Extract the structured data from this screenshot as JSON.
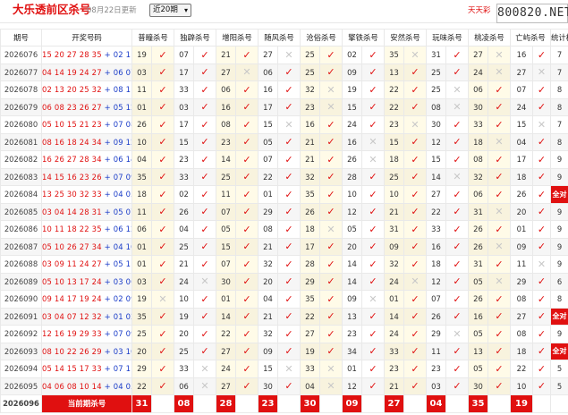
{
  "header": {
    "title": "大乐透前区杀号",
    "update_time": "08月22日更新",
    "period_select": "近20期",
    "site_name": "天天彩",
    "watermark": "800820.NET"
  },
  "table": {
    "headers": [
      "期号",
      "开奖号码",
      "普疃杀号",
      "独辟杀号",
      "增阳杀号",
      "随风杀号",
      "沧俗杀号",
      "擎铁杀号",
      "安然杀号",
      "玩味杀号",
      "桃凌杀号",
      "亡屿杀号",
      "统计概况"
    ],
    "rows": [
      {
        "issue": "2026076",
        "front": "15 20 27 28 35",
        "back": "02 11",
        "kills": [
          [
            "19",
            "ok"
          ],
          [
            "07",
            "ok"
          ],
          [
            "21",
            "ok"
          ],
          [
            "27",
            "no"
          ],
          [
            "25",
            "ok"
          ],
          [
            "02",
            "ok"
          ],
          [
            "35",
            "no"
          ],
          [
            "31",
            "ok"
          ],
          [
            "27",
            "no"
          ],
          [
            "16",
            "ok"
          ]
        ],
        "count": "7"
      },
      {
        "issue": "2026077",
        "front": "04 14 19 24 27",
        "back": "06 07",
        "kills": [
          [
            "03",
            "ok"
          ],
          [
            "17",
            "ok"
          ],
          [
            "27",
            "no"
          ],
          [
            "06",
            "ok"
          ],
          [
            "25",
            "ok"
          ],
          [
            "09",
            "ok"
          ],
          [
            "13",
            "ok"
          ],
          [
            "25",
            "ok"
          ],
          [
            "24",
            "no"
          ],
          [
            "27",
            "no"
          ]
        ],
        "count": "7"
      },
      {
        "issue": "2026078",
        "front": "02 13 20 25 32",
        "back": "08 11",
        "kills": [
          [
            "11",
            "ok"
          ],
          [
            "33",
            "ok"
          ],
          [
            "06",
            "ok"
          ],
          [
            "16",
            "ok"
          ],
          [
            "32",
            "no"
          ],
          [
            "19",
            "ok"
          ],
          [
            "22",
            "ok"
          ],
          [
            "25",
            "no"
          ],
          [
            "06",
            "ok"
          ],
          [
            "07",
            "ok"
          ]
        ],
        "count": "8"
      },
      {
        "issue": "2026079",
        "front": "06 08 23 26 27",
        "back": "05 12",
        "kills": [
          [
            "01",
            "ok"
          ],
          [
            "03",
            "ok"
          ],
          [
            "16",
            "ok"
          ],
          [
            "17",
            "ok"
          ],
          [
            "23",
            "no"
          ],
          [
            "15",
            "ok"
          ],
          [
            "22",
            "ok"
          ],
          [
            "08",
            "no"
          ],
          [
            "30",
            "ok"
          ],
          [
            "24",
            "ok"
          ]
        ],
        "count": "8"
      },
      {
        "issue": "2026080",
        "front": "05 10 15 21 23",
        "back": "07 08",
        "kills": [
          [
            "26",
            "ok"
          ],
          [
            "17",
            "ok"
          ],
          [
            "08",
            "ok"
          ],
          [
            "15",
            "no"
          ],
          [
            "16",
            "ok"
          ],
          [
            "24",
            "ok"
          ],
          [
            "23",
            "no"
          ],
          [
            "30",
            "ok"
          ],
          [
            "33",
            "ok"
          ],
          [
            "15",
            "no"
          ]
        ],
        "count": "7"
      },
      {
        "issue": "2026081",
        "front": "08 16 18 24 34",
        "back": "09 12",
        "kills": [
          [
            "10",
            "ok"
          ],
          [
            "15",
            "ok"
          ],
          [
            "23",
            "ok"
          ],
          [
            "05",
            "ok"
          ],
          [
            "21",
            "ok"
          ],
          [
            "16",
            "no"
          ],
          [
            "15",
            "ok"
          ],
          [
            "12",
            "ok"
          ],
          [
            "18",
            "no"
          ],
          [
            "04",
            "ok"
          ]
        ],
        "count": "8"
      },
      {
        "issue": "2026082",
        "front": "16 26 27 28 34",
        "back": "06 14",
        "kills": [
          [
            "04",
            "ok"
          ],
          [
            "23",
            "ok"
          ],
          [
            "14",
            "ok"
          ],
          [
            "07",
            "ok"
          ],
          [
            "21",
            "ok"
          ],
          [
            "26",
            "no"
          ],
          [
            "18",
            "ok"
          ],
          [
            "15",
            "ok"
          ],
          [
            "08",
            "ok"
          ],
          [
            "17",
            "ok"
          ]
        ],
        "count": "9"
      },
      {
        "issue": "2026083",
        "front": "14 15 16 23 26",
        "back": "07 09",
        "kills": [
          [
            "35",
            "ok"
          ],
          [
            "33",
            "ok"
          ],
          [
            "25",
            "ok"
          ],
          [
            "22",
            "ok"
          ],
          [
            "32",
            "ok"
          ],
          [
            "28",
            "ok"
          ],
          [
            "25",
            "ok"
          ],
          [
            "14",
            "no"
          ],
          [
            "32",
            "ok"
          ],
          [
            "18",
            "ok"
          ]
        ],
        "count": "9"
      },
      {
        "issue": "2026084",
        "front": "13 25 30 32 33",
        "back": "04 05",
        "kills": [
          [
            "18",
            "ok"
          ],
          [
            "02",
            "ok"
          ],
          [
            "11",
            "ok"
          ],
          [
            "01",
            "ok"
          ],
          [
            "35",
            "ok"
          ],
          [
            "10",
            "ok"
          ],
          [
            "10",
            "ok"
          ],
          [
            "27",
            "ok"
          ],
          [
            "06",
            "ok"
          ],
          [
            "26",
            "ok"
          ]
        ],
        "count": "全对"
      },
      {
        "issue": "2026085",
        "front": "03 04 14 28 31",
        "back": "05 07",
        "kills": [
          [
            "11",
            "ok"
          ],
          [
            "26",
            "ok"
          ],
          [
            "07",
            "ok"
          ],
          [
            "29",
            "ok"
          ],
          [
            "26",
            "ok"
          ],
          [
            "12",
            "ok"
          ],
          [
            "21",
            "ok"
          ],
          [
            "22",
            "ok"
          ],
          [
            "31",
            "no"
          ],
          [
            "20",
            "ok"
          ]
        ],
        "count": "9"
      },
      {
        "issue": "2026086",
        "front": "10 11 18 22 35",
        "back": "06 12",
        "kills": [
          [
            "06",
            "ok"
          ],
          [
            "04",
            "ok"
          ],
          [
            "05",
            "ok"
          ],
          [
            "08",
            "ok"
          ],
          [
            "18",
            "no"
          ],
          [
            "05",
            "ok"
          ],
          [
            "31",
            "ok"
          ],
          [
            "33",
            "ok"
          ],
          [
            "26",
            "ok"
          ],
          [
            "01",
            "ok"
          ]
        ],
        "count": "9"
      },
      {
        "issue": "2026087",
        "front": "05 10 26 27 34",
        "back": "04 10",
        "kills": [
          [
            "01",
            "ok"
          ],
          [
            "25",
            "ok"
          ],
          [
            "15",
            "ok"
          ],
          [
            "21",
            "ok"
          ],
          [
            "17",
            "ok"
          ],
          [
            "20",
            "ok"
          ],
          [
            "09",
            "ok"
          ],
          [
            "16",
            "ok"
          ],
          [
            "26",
            "no"
          ],
          [
            "09",
            "ok"
          ]
        ],
        "count": "9"
      },
      {
        "issue": "2026088",
        "front": "03 09 11 24 27",
        "back": "05 11",
        "kills": [
          [
            "01",
            "ok"
          ],
          [
            "21",
            "ok"
          ],
          [
            "07",
            "ok"
          ],
          [
            "32",
            "ok"
          ],
          [
            "28",
            "ok"
          ],
          [
            "14",
            "ok"
          ],
          [
            "32",
            "ok"
          ],
          [
            "18",
            "ok"
          ],
          [
            "31",
            "ok"
          ],
          [
            "11",
            "no"
          ]
        ],
        "count": "9"
      },
      {
        "issue": "2026089",
        "front": "05 10 13 17 24",
        "back": "03 06",
        "kills": [
          [
            "03",
            "ok"
          ],
          [
            "24",
            "no"
          ],
          [
            "30",
            "ok"
          ],
          [
            "20",
            "ok"
          ],
          [
            "29",
            "ok"
          ],
          [
            "14",
            "ok"
          ],
          [
            "24",
            "no"
          ],
          [
            "12",
            "ok"
          ],
          [
            "05",
            "no"
          ],
          [
            "29",
            "ok"
          ]
        ],
        "count": "6"
      },
      {
        "issue": "2026090",
        "front": "09 14 17 19 24",
        "back": "02 09",
        "kills": [
          [
            "19",
            "no"
          ],
          [
            "10",
            "ok"
          ],
          [
            "01",
            "ok"
          ],
          [
            "04",
            "ok"
          ],
          [
            "35",
            "ok"
          ],
          [
            "09",
            "no"
          ],
          [
            "01",
            "ok"
          ],
          [
            "07",
            "ok"
          ],
          [
            "26",
            "ok"
          ],
          [
            "08",
            "ok"
          ]
        ],
        "count": "8"
      },
      {
        "issue": "2026091",
        "front": "03 04 07 12 32",
        "back": "01 02",
        "kills": [
          [
            "35",
            "ok"
          ],
          [
            "19",
            "ok"
          ],
          [
            "14",
            "ok"
          ],
          [
            "21",
            "ok"
          ],
          [
            "22",
            "ok"
          ],
          [
            "13",
            "ok"
          ],
          [
            "14",
            "ok"
          ],
          [
            "26",
            "ok"
          ],
          [
            "16",
            "ok"
          ],
          [
            "27",
            "ok"
          ]
        ],
        "count": "全对"
      },
      {
        "issue": "2026092",
        "front": "12 16 19 29 33",
        "back": "07 09",
        "kills": [
          [
            "25",
            "ok"
          ],
          [
            "20",
            "ok"
          ],
          [
            "22",
            "ok"
          ],
          [
            "32",
            "ok"
          ],
          [
            "27",
            "ok"
          ],
          [
            "23",
            "ok"
          ],
          [
            "24",
            "ok"
          ],
          [
            "29",
            "no"
          ],
          [
            "05",
            "ok"
          ],
          [
            "08",
            "ok"
          ]
        ],
        "count": "9"
      },
      {
        "issue": "2026093",
        "front": "08 10 22 26 29",
        "back": "03 10",
        "kills": [
          [
            "20",
            "ok"
          ],
          [
            "25",
            "ok"
          ],
          [
            "27",
            "ok"
          ],
          [
            "09",
            "ok"
          ],
          [
            "19",
            "ok"
          ],
          [
            "34",
            "ok"
          ],
          [
            "33",
            "ok"
          ],
          [
            "11",
            "ok"
          ],
          [
            "13",
            "ok"
          ],
          [
            "18",
            "ok"
          ]
        ],
        "count": "全对"
      },
      {
        "issue": "2026094",
        "front": "05 14 15 17 33",
        "back": "07 11",
        "kills": [
          [
            "29",
            "ok"
          ],
          [
            "33",
            "no"
          ],
          [
            "24",
            "ok"
          ],
          [
            "15",
            "no"
          ],
          [
            "33",
            "no"
          ],
          [
            "01",
            "ok"
          ],
          [
            "23",
            "ok"
          ],
          [
            "23",
            "ok"
          ],
          [
            "05",
            "ok"
          ],
          [
            "22",
            "ok"
          ]
        ],
        "count": "5"
      },
      {
        "issue": "2026095",
        "front": "04 06 08 10 14",
        "back": "04 05",
        "kills": [
          [
            "22",
            "ok"
          ],
          [
            "06",
            "no"
          ],
          [
            "27",
            "ok"
          ],
          [
            "30",
            "ok"
          ],
          [
            "04",
            "no"
          ],
          [
            "12",
            "ok"
          ],
          [
            "21",
            "ok"
          ],
          [
            "03",
            "ok"
          ],
          [
            "30",
            "ok"
          ],
          [
            "10",
            "ok"
          ]
        ],
        "count": "5"
      }
    ],
    "current": {
      "issue": "2026096",
      "label": "当前期杀号",
      "kills": [
        "31",
        "08",
        "28",
        "23",
        "30",
        "09",
        "27",
        "04",
        "35",
        "19"
      ]
    }
  }
}
